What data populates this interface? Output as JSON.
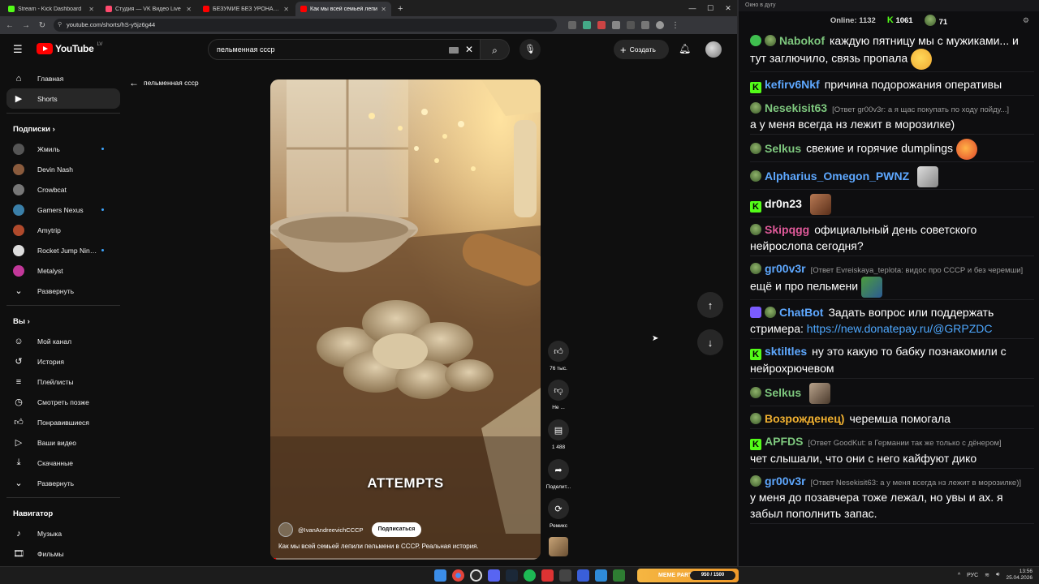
{
  "browser": {
    "tabs": [
      {
        "title": "Stream - Kick Dashboard",
        "color": "#53fc18",
        "active": false
      },
      {
        "title": "Студия — VK Видео Live",
        "color": "#ff4a6e",
        "active": false
      },
      {
        "title": "БЕЗУМИЕ БЕЗ УРОНА ЗА 4 ЧАСА",
        "color": "#ff0000",
        "active": false
      },
      {
        "title": "Как мы всей семьей лепи",
        "color": "#ff0000",
        "active": true
      }
    ],
    "url": "youtube.com/shorts/hS-y5jz6g44",
    "new_tab": "+",
    "controls": {
      "minimize": "—",
      "maximize": "☐",
      "close": "✕"
    }
  },
  "youtube": {
    "logo_text": "YouTube",
    "region": "LV",
    "search_value": "пельменная ссср",
    "create_label": "Создать",
    "guide": {
      "main": [
        {
          "label": "Главная",
          "icon": "home-icon",
          "active": false
        },
        {
          "label": "Shorts",
          "icon": "shorts-icon",
          "active": true
        }
      ],
      "subs_header": "Подписки",
      "subs": [
        {
          "label": "Жмиль",
          "color": "#555",
          "dot": true
        },
        {
          "label": "Devin Nash",
          "color": "#8a5b3d",
          "dot": false
        },
        {
          "label": "Crowbcat",
          "color": "#777",
          "dot": false
        },
        {
          "label": "Gamers Nexus",
          "color": "#3a7fa8",
          "dot": true
        },
        {
          "label": "Amytrip",
          "color": "#b04a2c",
          "dot": false
        },
        {
          "label": "Rocket Jump Nin…",
          "color": "#ddd",
          "dot": true
        },
        {
          "label": "Metalyst",
          "color": "#c2389a",
          "dot": false
        }
      ],
      "subs_expand": "Развернуть",
      "you_header": "Вы",
      "you": [
        {
          "label": "Мой канал",
          "icon": "channel-icon"
        },
        {
          "label": "История",
          "icon": "history-icon"
        },
        {
          "label": "Плейлисты",
          "icon": "playlists-icon"
        },
        {
          "label": "Смотреть позже",
          "icon": "watch-later-icon"
        },
        {
          "label": "Понравившиеся",
          "icon": "liked-icon"
        },
        {
          "label": "Ваши видео",
          "icon": "your-videos-icon"
        },
        {
          "label": "Скачанные",
          "icon": "downloads-icon"
        }
      ],
      "you_expand": "Развернуть",
      "nav_header": "Навигатор",
      "nav": [
        {
          "label": "Музыка",
          "icon": "music-icon"
        },
        {
          "label": "Фильмы",
          "icon": "movies-icon"
        }
      ]
    },
    "short": {
      "back_label": "пельменная ссср",
      "overlay_text": "ATTEMPTS",
      "channel": "@IvanAndreevichCCCP",
      "subscribe": "Подписаться",
      "title": "Как мы всей семьей лепили пельмени в СССР. Реальная история.",
      "progress": 0.02,
      "likes": "76 тыс.",
      "dislike": "Не ...",
      "comments": "1 488",
      "share": "Поделит...",
      "remix": "Ремикс"
    }
  },
  "chat": {
    "window_title": "Окно в дугу",
    "online_label": "Online:",
    "online_count": "1132",
    "kick_count": "1061",
    "other_count": "71",
    "messages": [
      {
        "user": "Nabokof",
        "color": "#7ec87e",
        "badges": [
          "mod",
          "frog"
        ],
        "reply": "",
        "text": "каждую пятницу мы с мужиками... и тут заглючило, связь пропала",
        "emote": "think"
      },
      {
        "user": "kefirv6Nkf",
        "color": "#5ea8ff",
        "badges": [
          "k"
        ],
        "reply": "",
        "text": "причина подорожания оперативы",
        "emote": ""
      },
      {
        "user": "Nesekisit63",
        "color": "#7ec87e",
        "badges": [
          "frog"
        ],
        "reply": "[Ответ gr00v3r: а я щас покупать по ходу пойду...]",
        "text": "а у меня всегда нз лежит в морозилке)",
        "emote": ""
      },
      {
        "user": "Selkus",
        "color": "#7ec87e",
        "badges": [
          "frog"
        ],
        "reply": "",
        "text": "свежие и горячие dumplings",
        "emote": "hot"
      },
      {
        "user": "Alpharius_Omegon_PWNZ",
        "color": "#5ea8ff",
        "badges": [
          "frog"
        ],
        "reply": "",
        "text": "",
        "emote": "cat"
      },
      {
        "user": "dr0n23",
        "color": "#ffffff",
        "badges": [
          "k"
        ],
        "reply": "",
        "text": "",
        "emote": "man"
      },
      {
        "user": "Skipqgg",
        "color": "#e05a9a",
        "badges": [
          "frog"
        ],
        "reply": "",
        "text": "официальный день советского нейрослопа сегодня?",
        "emote": ""
      },
      {
        "user": "gr00v3r",
        "color": "#5ea8ff",
        "badges": [
          "frog"
        ],
        "reply": "[Ответ Evreiskaya_teplota: видос про СССР и без черемши]",
        "text": "ещё и про пельмени",
        "emote": "pepe"
      },
      {
        "user": "ChatBot",
        "color": "#5ea8ff",
        "badges": [
          "bot",
          "frog"
        ],
        "reply": "",
        "text": "Задать вопрос или поддержать стримера:",
        "link": "https://new.donatepay.ru/@GRPZDC",
        "emote": ""
      },
      {
        "user": "sktiltles",
        "color": "#5ea8ff",
        "badges": [
          "k"
        ],
        "reply": "",
        "text": "ну это какую то бабку познакомили с нейрохрючевом",
        "emote": ""
      },
      {
        "user": "Selkus",
        "color": "#7ec87e",
        "badges": [
          "frog"
        ],
        "reply": "",
        "text": "",
        "emote": "cat2"
      },
      {
        "user": "Возрожденец)",
        "color": "#f0b030",
        "badges": [
          "frog"
        ],
        "reply": "",
        "text": "черемша помогала",
        "emote": ""
      },
      {
        "user": "APFDS",
        "color": "#7ec87e",
        "badges": [
          "k"
        ],
        "reply": "[Ответ GoodKut: в Германии так же только с дёнером]",
        "text": "чет слышали, что они с него кайфуют дико",
        "emote": ""
      },
      {
        "user": "gr00v3r",
        "color": "#5ea8ff",
        "badges": [
          "frog"
        ],
        "reply": "[Ответ Nesekisit63: а у меня всегда нз лежит в морозилке)]",
        "text": "у меня до позавчера тоже лежал, но увы и ах. я забыл пополнить запас.",
        "emote": ""
      }
    ]
  },
  "taskbar": {
    "meme_party": "MEME PARTY",
    "meme_progress": "950 / 1500",
    "lang": "РУС",
    "time": "13:56",
    "date": "25.04.2026"
  }
}
